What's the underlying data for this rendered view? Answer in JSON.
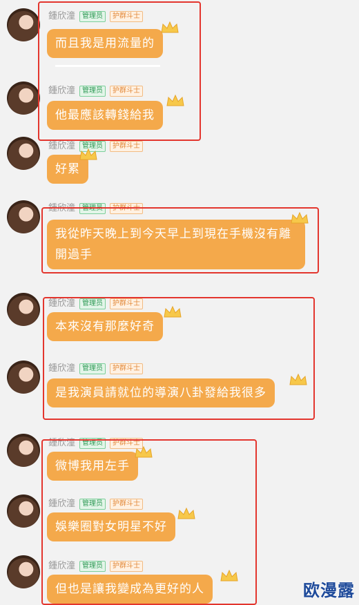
{
  "user": {
    "name": "鍾欣潼",
    "badge_admin": "管理员",
    "badge_guard": "护群斗士"
  },
  "messages": [
    {
      "text": "而且我是用流量的"
    },
    {
      "text": "他最應該轉錢給我"
    },
    {
      "text": "好累"
    },
    {
      "text": "我從昨天晚上到今天早上到現在手機沒有離開過手"
    },
    {
      "text": "本來沒有那麼好奇"
    },
    {
      "text": "是我演員請就位的導演八卦發給我很多"
    },
    {
      "text": "微博我用左手"
    },
    {
      "text": "娛樂圈對女明星不好"
    },
    {
      "text": "但也是讓我變成為更好的人"
    }
  ],
  "watermark": "欧漫露",
  "colors": {
    "bubble": "#f4a94b",
    "highlight_frame": "#e3352d",
    "admin_badge": "#2f9a55",
    "guard_badge": "#e2893a"
  }
}
